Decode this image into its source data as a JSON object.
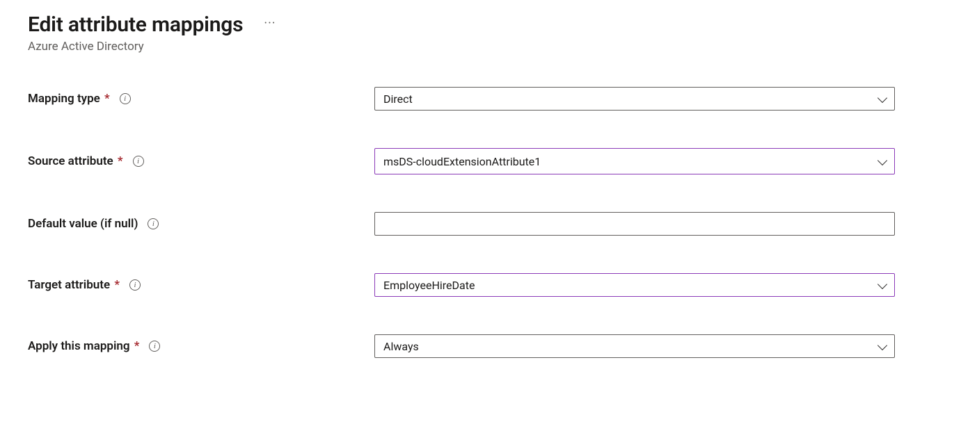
{
  "header": {
    "title": "Edit attribute mappings",
    "subtitle": "Azure Active Directory"
  },
  "fields": {
    "mappingType": {
      "label": "Mapping type",
      "required": true,
      "value": "Direct"
    },
    "sourceAttribute": {
      "label": "Source attribute",
      "required": true,
      "value": "msDS-cloudExtensionAttribute1"
    },
    "defaultValue": {
      "label": "Default value (if null)",
      "required": false,
      "value": ""
    },
    "targetAttribute": {
      "label": "Target attribute",
      "required": true,
      "value": "EmployeeHireDate"
    },
    "applyMapping": {
      "label": "Apply this mapping",
      "required": true,
      "value": "Always"
    }
  }
}
